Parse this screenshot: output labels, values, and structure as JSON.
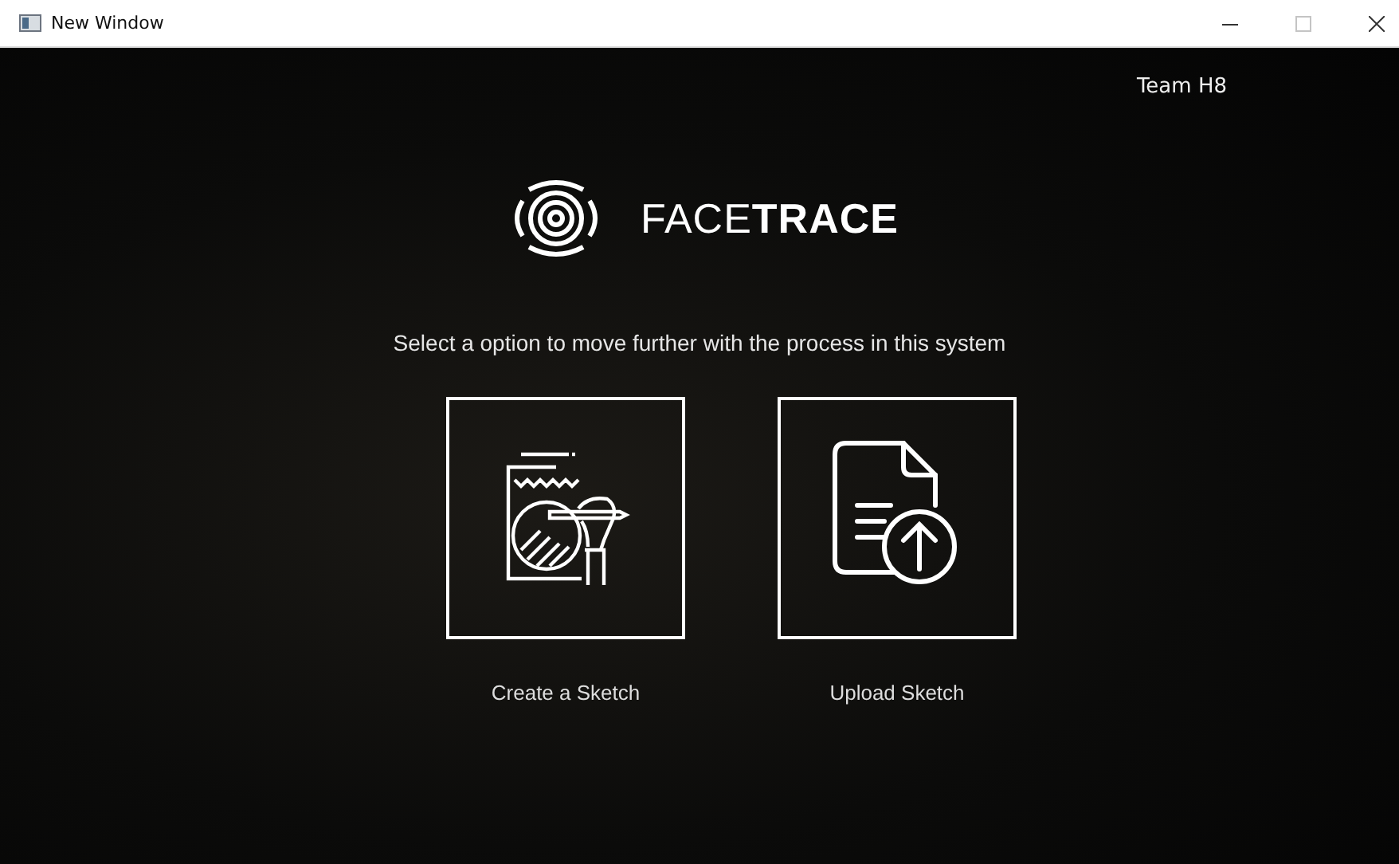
{
  "window": {
    "title": "New Window"
  },
  "team_label": "Team H8",
  "logo": {
    "text": "FACE**TRACE**"
  },
  "instruction": "Select a option to move further with the process in this system",
  "options": [
    {
      "kind": "create",
      "label": "Create a Sketch"
    },
    {
      "kind": "upload",
      "label": "Upload Sketch"
    }
  ]
}
